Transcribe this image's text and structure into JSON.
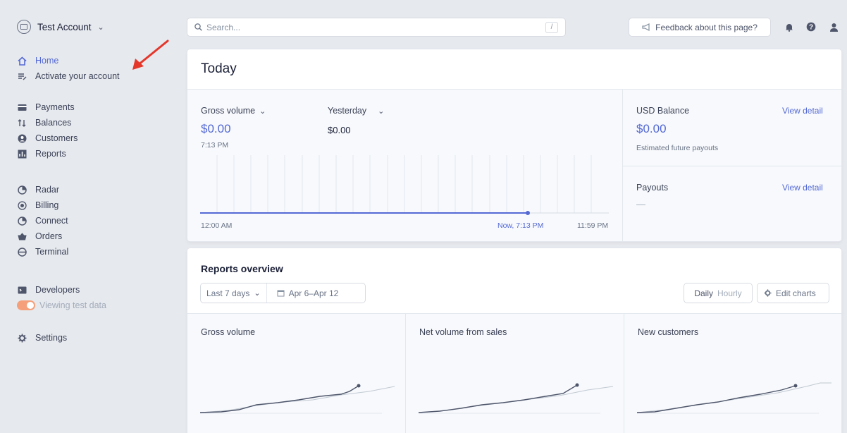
{
  "sidebar": {
    "account_name": "Test Account",
    "items": [
      {
        "label": "Home",
        "icon": "home-icon",
        "active": true
      },
      {
        "label": "Activate your account",
        "icon": "list-edit-icon"
      },
      {
        "label": "Payments",
        "icon": "payments-icon"
      },
      {
        "label": "Balances",
        "icon": "balances-icon"
      },
      {
        "label": "Customers",
        "icon": "customers-icon"
      },
      {
        "label": "Reports",
        "icon": "reports-icon"
      },
      {
        "label": "Radar",
        "icon": "radar-icon"
      },
      {
        "label": "Billing",
        "icon": "billing-icon"
      },
      {
        "label": "Connect",
        "icon": "connect-icon"
      },
      {
        "label": "Orders",
        "icon": "orders-icon"
      },
      {
        "label": "Terminal",
        "icon": "terminal-icon"
      },
      {
        "label": "Developers",
        "icon": "developers-icon"
      },
      {
        "label": "Viewing test data",
        "icon": "test-data-toggle"
      },
      {
        "label": "Settings",
        "icon": "gear-icon"
      }
    ]
  },
  "topbar": {
    "search_placeholder": "Search...",
    "search_shortcut": "/",
    "feedback_label": "Feedback about this page?"
  },
  "today": {
    "title": "Today",
    "gross_volume_label": "Gross volume",
    "gross_volume_value": "$0.00",
    "gross_volume_time": "7:13 PM",
    "compare_label": "Yesterday",
    "compare_value": "$0.00",
    "axis_start": "12:00 AM",
    "axis_now": "Now, 7:13 PM",
    "axis_end": "11:59 PM",
    "balance_label": "USD Balance",
    "balance_value": "$0.00",
    "balance_note": "Estimated future payouts",
    "payouts_label": "Payouts",
    "payouts_value": "—",
    "view_detail": "View detail"
  },
  "reports": {
    "title": "Reports overview",
    "range_label": "Last 7 days",
    "date_range": "Apr 6–Apr 12",
    "granularity_active": "Daily",
    "granularity_inactive": "Hourly",
    "edit_charts": "Edit charts",
    "charts": [
      {
        "label": "Gross volume"
      },
      {
        "label": "Net volume from sales"
      },
      {
        "label": "New customers"
      }
    ]
  },
  "colors": {
    "accent": "#5469d4",
    "arrow": "#e5362a",
    "toggle": "#f5a07a"
  }
}
